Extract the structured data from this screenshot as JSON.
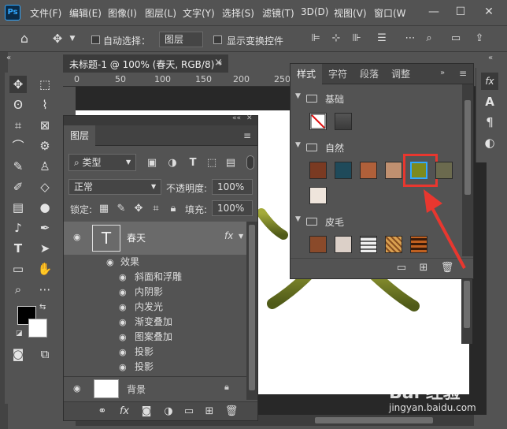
{
  "app": {
    "logo": "Ps"
  },
  "menu": [
    "文件(F)",
    "编辑(E)",
    "图像(I)",
    "图层(L)",
    "文字(Y)",
    "选择(S)",
    "滤镜(T)",
    "3D(D)",
    "视图(V)",
    "窗口(W"
  ],
  "window_buttons": {
    "minimize": "—",
    "maximize": "☐",
    "close": "✕"
  },
  "options_bar": {
    "auto_select_label": "自动选择：",
    "auto_select_value": "图层",
    "show_transform_label": "显示变换控件"
  },
  "document": {
    "tab_title": "未标题-1 @ 100% (春天, RGB/8) *",
    "close": "×",
    "ruler": [
      "0",
      "50",
      "100",
      "150",
      "200",
      "250"
    ]
  },
  "layers_panel": {
    "title": "图层",
    "filter_value": "类型",
    "blend_mode": "正常",
    "opacity_label": "不透明度:",
    "opacity_value": "100%",
    "lock_label": "锁定:",
    "fill_label": "填充:",
    "fill_value": "100%",
    "layers": [
      {
        "name": "春天",
        "thumb": "T",
        "fx": "fx"
      },
      {
        "name": "背景"
      }
    ],
    "effects_label": "效果",
    "effects": [
      "斜面和浮雕",
      "内阴影",
      "内发光",
      "渐变叠加",
      "图案叠加",
      "投影",
      "投影"
    ],
    "footer_icons": [
      "link-icon",
      "fx-icon",
      "mask-icon",
      "adjustment-icon",
      "folder-icon",
      "new-layer-icon",
      "trash-icon"
    ]
  },
  "styles_panel": {
    "tabs": [
      "样式",
      "字符",
      "段落",
      "调整"
    ],
    "active_tab": "样式",
    "groups": [
      {
        "name": "基础"
      },
      {
        "name": "自然"
      },
      {
        "name": "皮毛"
      }
    ]
  },
  "watermark": {
    "text": "Bai 经验",
    "url": "jingyan.baidu.com"
  },
  "colors": {
    "highlight": "#e8372f",
    "selected_swatch_border": "#31a8ff"
  }
}
